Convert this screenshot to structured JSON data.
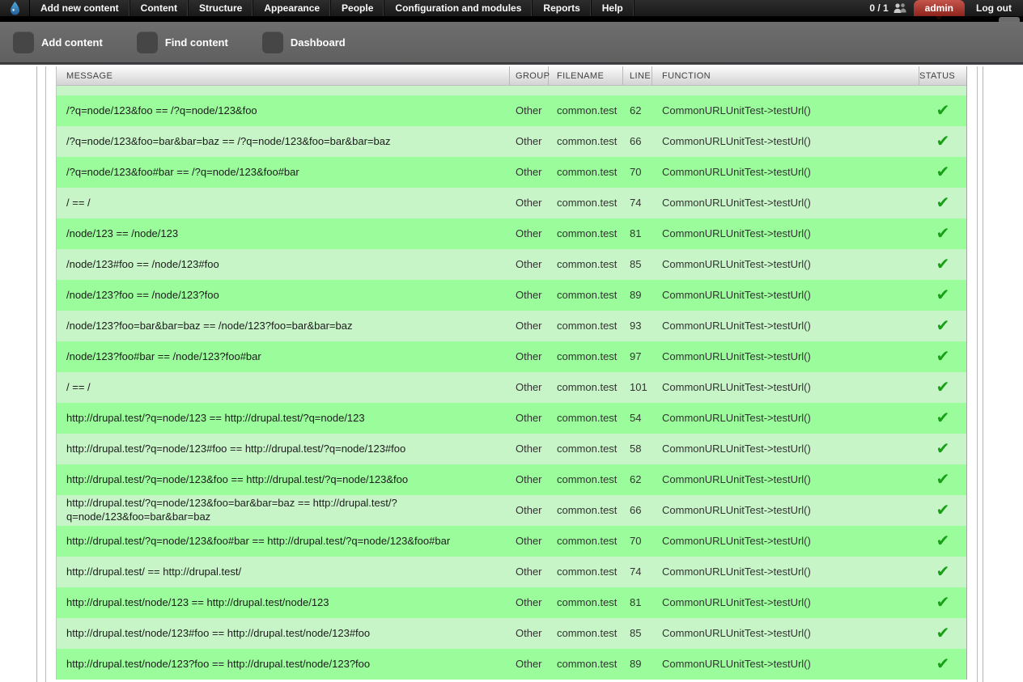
{
  "toolbar": {
    "menu": [
      "Add new content",
      "Content",
      "Structure",
      "Appearance",
      "People",
      "Configuration and modules",
      "Reports",
      "Help"
    ],
    "counter": "0 / 1",
    "user": "admin",
    "logout": "Log out"
  },
  "shortcuts": {
    "items": [
      "Add content",
      "Find content",
      "Dashboard"
    ]
  },
  "icons": {
    "logo": "drupal-droplet",
    "users": "two-people-silhouette",
    "shortcut_placeholder": "dark-rounded-square",
    "status_pass": "✔"
  },
  "colors": {
    "row_pass_dark": "#9afc9a",
    "row_pass_light": "#c7f5c7",
    "check_green": "#17a017",
    "admin_red": "#a9352c",
    "toolbar_black": "#1f1f1f",
    "shortcut_gray": "#666666"
  },
  "table": {
    "headers": [
      "MESSAGE",
      "GROUP",
      "FILENAME",
      "LINE",
      "FUNCTION",
      "STATUS"
    ],
    "rows": [
      {
        "message": "/?q=node/123&foo == /?q=node/123&foo",
        "group": "Other",
        "filename": "common.test",
        "line": "62",
        "function": "CommonURLUnitTest->testUrl()",
        "status": "pass"
      },
      {
        "message": "/?q=node/123&foo=bar&bar=baz == /?q=node/123&foo=bar&bar=baz",
        "group": "Other",
        "filename": "common.test",
        "line": "66",
        "function": "CommonURLUnitTest->testUrl()",
        "status": "pass"
      },
      {
        "message": "/?q=node/123&foo#bar == /?q=node/123&foo#bar",
        "group": "Other",
        "filename": "common.test",
        "line": "70",
        "function": "CommonURLUnitTest->testUrl()",
        "status": "pass"
      },
      {
        "message": "/ == /",
        "group": "Other",
        "filename": "common.test",
        "line": "74",
        "function": "CommonURLUnitTest->testUrl()",
        "status": "pass"
      },
      {
        "message": "/node/123 == /node/123",
        "group": "Other",
        "filename": "common.test",
        "line": "81",
        "function": "CommonURLUnitTest->testUrl()",
        "status": "pass"
      },
      {
        "message": "/node/123#foo == /node/123#foo",
        "group": "Other",
        "filename": "common.test",
        "line": "85",
        "function": "CommonURLUnitTest->testUrl()",
        "status": "pass"
      },
      {
        "message": "/node/123?foo == /node/123?foo",
        "group": "Other",
        "filename": "common.test",
        "line": "89",
        "function": "CommonURLUnitTest->testUrl()",
        "status": "pass"
      },
      {
        "message": "/node/123?foo=bar&bar=baz == /node/123?foo=bar&bar=baz",
        "group": "Other",
        "filename": "common.test",
        "line": "93",
        "function": "CommonURLUnitTest->testUrl()",
        "status": "pass"
      },
      {
        "message": "/node/123?foo#bar == /node/123?foo#bar",
        "group": "Other",
        "filename": "common.test",
        "line": "97",
        "function": "CommonURLUnitTest->testUrl()",
        "status": "pass"
      },
      {
        "message": "/ == /",
        "group": "Other",
        "filename": "common.test",
        "line": "101",
        "function": "CommonURLUnitTest->testUrl()",
        "status": "pass"
      },
      {
        "message": "http://drupal.test/?q=node/123 == http://drupal.test/?q=node/123",
        "group": "Other",
        "filename": "common.test",
        "line": "54",
        "function": "CommonURLUnitTest->testUrl()",
        "status": "pass"
      },
      {
        "message": "http://drupal.test/?q=node/123#foo == http://drupal.test/?q=node/123#foo",
        "group": "Other",
        "filename": "common.test",
        "line": "58",
        "function": "CommonURLUnitTest->testUrl()",
        "status": "pass"
      },
      {
        "message": "http://drupal.test/?q=node/123&foo == http://drupal.test/?q=node/123&foo",
        "group": "Other",
        "filename": "common.test",
        "line": "62",
        "function": "CommonURLUnitTest->testUrl()",
        "status": "pass"
      },
      {
        "message": "http://drupal.test/?q=node/123&foo=bar&bar=baz == http://drupal.test/?q=node/123&foo=bar&bar=baz",
        "group": "Other",
        "filename": "common.test",
        "line": "66",
        "function": "CommonURLUnitTest->testUrl()",
        "status": "pass"
      },
      {
        "message": "http://drupal.test/?q=node/123&foo#bar == http://drupal.test/?q=node/123&foo#bar",
        "group": "Other",
        "filename": "common.test",
        "line": "70",
        "function": "CommonURLUnitTest->testUrl()",
        "status": "pass"
      },
      {
        "message": "http://drupal.test/ == http://drupal.test/",
        "group": "Other",
        "filename": "common.test",
        "line": "74",
        "function": "CommonURLUnitTest->testUrl()",
        "status": "pass"
      },
      {
        "message": "http://drupal.test/node/123 == http://drupal.test/node/123",
        "group": "Other",
        "filename": "common.test",
        "line": "81",
        "function": "CommonURLUnitTest->testUrl()",
        "status": "pass"
      },
      {
        "message": "http://drupal.test/node/123#foo == http://drupal.test/node/123#foo",
        "group": "Other",
        "filename": "common.test",
        "line": "85",
        "function": "CommonURLUnitTest->testUrl()",
        "status": "pass"
      },
      {
        "message": "http://drupal.test/node/123?foo == http://drupal.test/node/123?foo",
        "group": "Other",
        "filename": "common.test",
        "line": "89",
        "function": "CommonURLUnitTest->testUrl()",
        "status": "pass"
      }
    ]
  }
}
